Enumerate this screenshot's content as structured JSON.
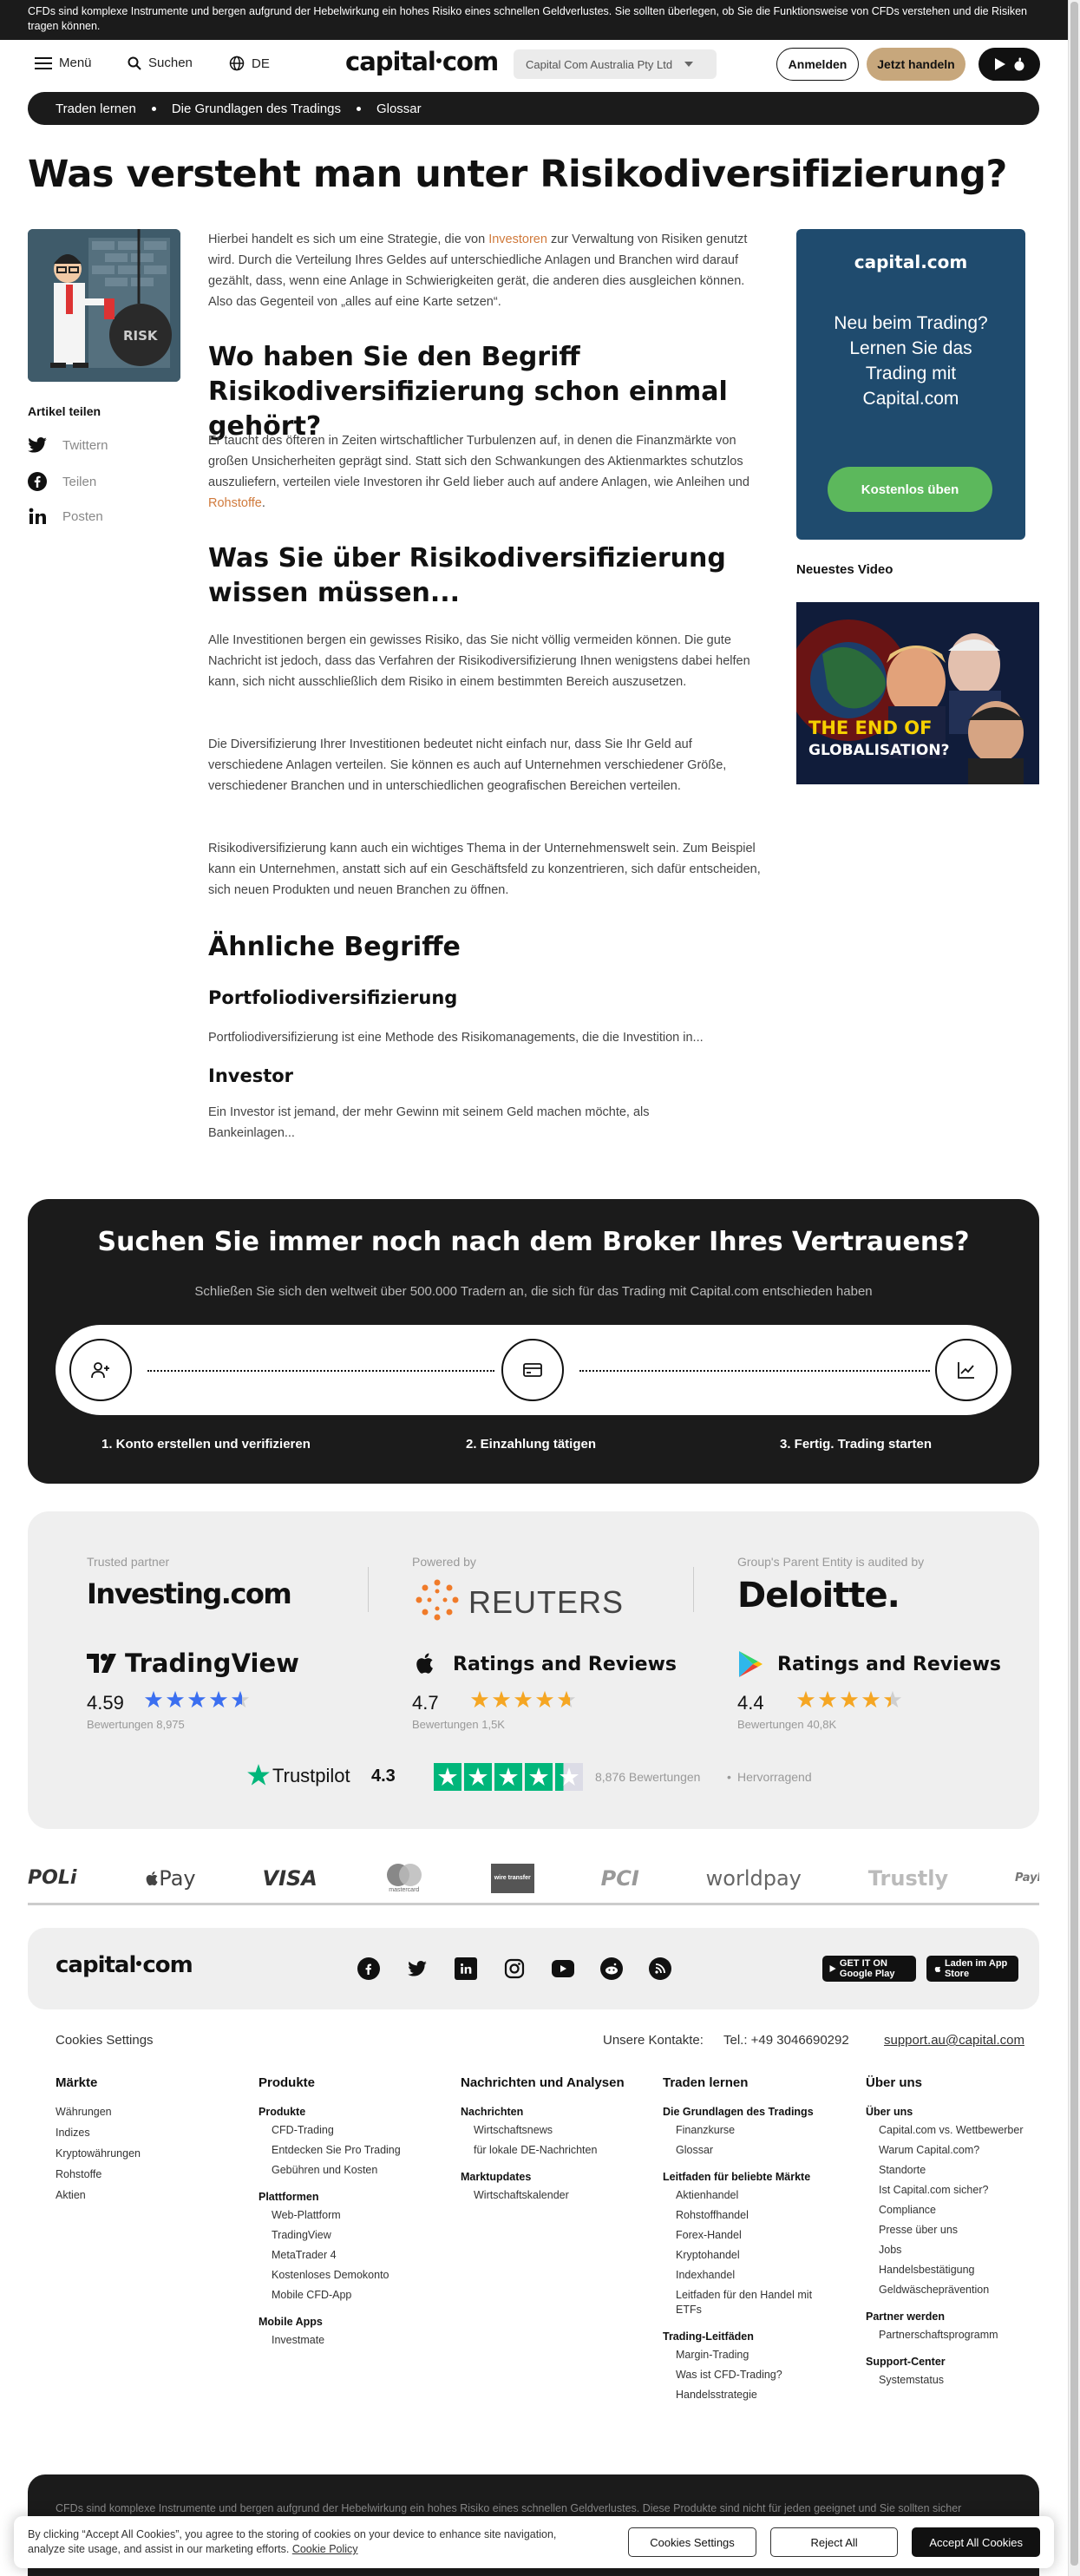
{
  "risk_warning": "CFDs sind komplexe Instrumente und bergen aufgrund der Hebelwirkung ein hohes Risiko eines schnellen Geldverlustes. Sie sollten überlegen, ob Sie die Funktionsweise von CFDs verstehen und die Risiken tragen können.",
  "header": {
    "menu": "Menü",
    "search": "Suchen",
    "language": "DE",
    "logo_left": "capital",
    "logo_right": "com",
    "entity": "Capital Com Australia Pty Ltd",
    "login": "Anmelden",
    "trade": "Jetzt handeln"
  },
  "breadcrumb": [
    "Traden lernen",
    "Die Grundlagen des Tradings",
    "Glossar"
  ],
  "article": {
    "title": "Was versteht man unter Risikodiversifizierung?",
    "intro_pre": "Hierbei handelt es sich um eine Strategie, die von ",
    "intro_link": "Investoren",
    "intro_post": " zur Verwaltung von Risiken genutzt wird. Durch die Verteilung Ihres Geldes auf unterschiedliche Anlagen und Branchen wird darauf gezählt, dass, wenn eine Anlage in Schwierigkeiten gerät, die anderen dies ausgleichen können. Also das Gegenteil von „alles auf eine Karte setzen“.",
    "h2_1": "Wo haben Sie den Begriff Risikodiversifizierung schon einmal gehört?",
    "p1_pre": "Er taucht des öfteren in Zeiten wirtschaftlicher Turbulenzen auf, in denen die Finanzmärkte von großen Unsicherheiten geprägt sind. Statt sich den Schwankungen des Aktienmarktes schutzlos auszuliefern, verteilen viele Investoren ihr Geld lieber auch auf andere Anlagen, wie Anleihen und ",
    "p1_link": "Rohstoffe",
    "p1_post": ".",
    "h2_2": "Was Sie über Risikodiversifizierung wissen müssen...",
    "p2": "Alle Investitionen bergen ein gewisses Risiko, das Sie nicht völlig vermeiden können. Die gute Nachricht ist jedoch, dass das Verfahren der Risikodiversifizierung Ihnen wenigstens dabei helfen kann, sich nicht ausschließlich dem Risiko in einem bestimmten Bereich auszusetzen.",
    "p3": "Die Diversifizierung Ihrer Investitionen bedeutet nicht einfach nur, dass Sie Ihr Geld auf verschiedene Anlagen verteilen. Sie können es auch auf Unternehmen verschiedener Größe, verschiedener Branchen und in unterschiedlichen geografischen Bereichen verteilen.",
    "p4": "Risikodiversifizierung kann auch ein wichtiges Thema in der Unternehmenswelt sein. Zum Beispiel kann ein Unternehmen, anstatt sich auf ein Geschäftsfeld zu konzentrieren, sich dafür entscheiden, sich neuen Produkten und neuen Branchen zu öffnen.",
    "similar_title": "Ähnliche Begriffe",
    "terms": [
      {
        "title": "Portfoliodiversifizierung",
        "desc": "Portfoliodiversifizierung ist eine Methode des Risikomanagements, die die Investition in..."
      },
      {
        "title": "Investor",
        "desc": "Ein Investor ist jemand, der mehr Gewinn mit seinem Geld machen möchte, als Bankeinlagen..."
      }
    ]
  },
  "share": {
    "title": "Artikel teilen",
    "items": [
      "Twittern",
      "Teilen",
      "Posten"
    ]
  },
  "illustration": {
    "sign": "RISK"
  },
  "promo": {
    "logo": "capital.com",
    "text": "Neu beim Trading? Lernen Sie das Trading mit Capital.com",
    "button": "Kostenlos üben"
  },
  "video": {
    "title": "Neuestes Video",
    "caption_1": "THE END OF",
    "caption_2": "GLOBALISATION?"
  },
  "broker": {
    "title": "Suchen Sie immer noch nach dem Broker Ihres Vertrauens?",
    "subtitle": "Schließen Sie sich den weltweit über 500.000 Tradern an, die sich für das Trading mit Capital.com entschieden haben",
    "steps": [
      "1. Konto erstellen und verifizieren",
      "2. Einzahlung tätigen",
      "3. Fertig. Trading starten"
    ]
  },
  "trust": {
    "partners": [
      {
        "label": "Trusted partner",
        "name": "Investing.com"
      },
      {
        "label": "Powered by",
        "name": "REUTERS"
      },
      {
        "label": "Group's Parent Entity is audited by",
        "name": "Deloitte."
      }
    ],
    "ratings": [
      {
        "name": "TradingView",
        "score": "4.59",
        "count": "Bewertungen 8,975",
        "stars": 4.59,
        "color": "#3b6ff0"
      },
      {
        "name": "Ratings and Reviews",
        "score": "4.7",
        "count": "Bewertungen 1,5K",
        "stars": 4.7,
        "color": "#f5a623"
      },
      {
        "name": "Ratings and Reviews",
        "score": "4.4",
        "count": "Bewertungen 40,8K",
        "stars": 4.4,
        "color": "#f5a623"
      }
    ],
    "trustpilot": {
      "name": "Trustpilot",
      "score": "4.3",
      "count": "8,876 Bewertungen",
      "label": "Hervorragend",
      "stars": 4.3
    }
  },
  "payments": [
    "POLi",
    "Pay",
    "VISA",
    "mastercard",
    "wire transfer",
    "PCI",
    "worldpay",
    "Trustly",
    "PayPal"
  ],
  "footer": {
    "logo_left": "capital",
    "logo_right": "com",
    "stores": [
      "GET IT ON Google Play",
      "Laden im App Store"
    ],
    "cookies_settings": "Cookies Settings",
    "contacts_label": "Unsere Kontakte:",
    "phone": "Tel.: +49 3046690292",
    "email": "support.au@capital.com",
    "columns": [
      {
        "title": "Märkte",
        "items": [
          "Währungen",
          "Indizes",
          "Kryptowährungen",
          "Rohstoffe",
          "Aktien"
        ]
      },
      {
        "title": "Produkte",
        "groups": [
          {
            "title": "Produkte",
            "items": [
              "CFD-Trading",
              "Entdecken Sie Pro Trading",
              "Gebühren und Kosten"
            ]
          },
          {
            "title": "Plattformen",
            "items": [
              "Web-Plattform",
              "TradingView",
              "MetaTrader 4",
              "Kostenloses Demokonto",
              "Mobile CFD-App"
            ]
          },
          {
            "title": "Mobile Apps",
            "items": [
              "Investmate"
            ]
          }
        ]
      },
      {
        "title": "Nachrichten und Analysen",
        "groups": [
          {
            "title": "Nachrichten",
            "items": [
              "Wirtschaftsnews",
              "für lokale DE-Nachrichten"
            ]
          },
          {
            "title": "Marktupdates",
            "items": [
              "Wirtschaftskalender"
            ]
          }
        ]
      },
      {
        "title": "Traden lernen",
        "groups": [
          {
            "title": "Die Grundlagen des Tradings",
            "items": [
              "Finanzkurse",
              "Glossar"
            ]
          },
          {
            "title": "Leitfaden für beliebte Märkte",
            "items": [
              "Aktienhandel",
              "Rohstoffhandel",
              "Forex-Handel",
              "Kryptohandel",
              "Indexhandel",
              "Leitfaden für den Handel mit ETFs"
            ]
          },
          {
            "title": "Trading-Leitfäden",
            "items": [
              "Margin-Trading",
              "Was ist CFD-Trading?",
              "Handelsstrategie"
            ]
          }
        ]
      },
      {
        "title": "Über uns",
        "groups": [
          {
            "title": "Über uns",
            "items": [
              "Capital.com vs. Wettbewerber",
              "Warum Capital.com?",
              "Standorte",
              "Ist Capital.com sicher?",
              "Compliance",
              "Presse über uns",
              "Jobs",
              "Handelsbestätigung",
              "Geldwäscheprävention"
            ]
          },
          {
            "title": "Partner werden",
            "items": [
              "Partnerschaftsprogramm"
            ]
          },
          {
            "title": "Support-Center",
            "items": [
              "Systemstatus"
            ]
          }
        ]
      }
    ],
    "bottom_warning": "CFDs sind komplexe Instrumente und bergen aufgrund der Hebelwirkung ein hohes Risiko eines schnellen Geldverlustes. Diese Produkte sind nicht für jeden geeignet und Sie sollten sicher"
  },
  "cookie": {
    "text": "By clicking “Accept All Cookies”, you agree to the storing of cookies on your device to enhance site navigation, analyze site usage, and assist in our marketing efforts.",
    "policy": "Cookie Policy",
    "settings": "Cookies Settings",
    "reject": "Reject All",
    "accept": "Accept All Cookies"
  }
}
